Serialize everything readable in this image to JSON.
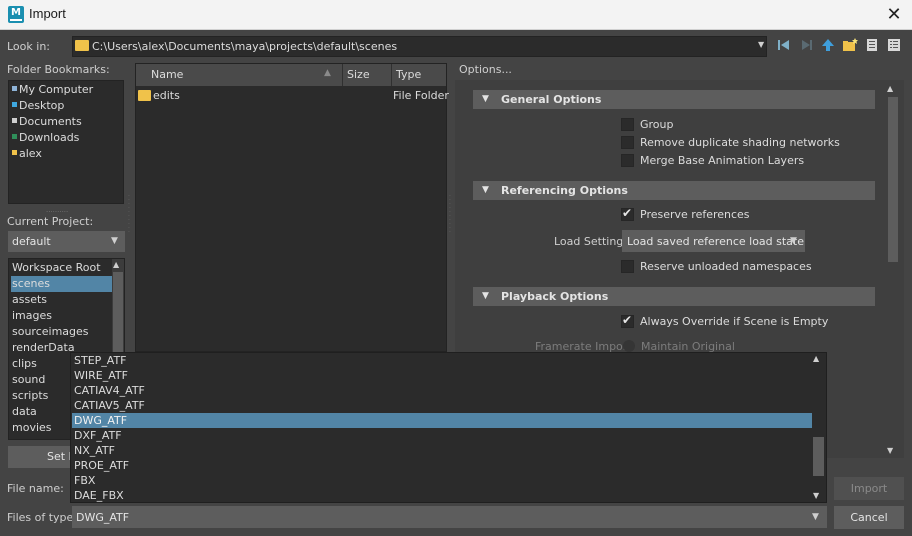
{
  "window": {
    "title": "Import",
    "app_icon": "M"
  },
  "look_in": {
    "label": "Look in:",
    "path": "C:\\Users\\alex\\Documents\\maya\\projects\\default\\scenes"
  },
  "toolbar": {
    "icons": [
      "back-icon",
      "forward-icon",
      "up-folder-icon",
      "new-folder-icon",
      "list-view-icon",
      "detail-view-icon"
    ]
  },
  "bookmarks": {
    "label": "Folder Bookmarks:",
    "items": [
      {
        "label": "My Computer",
        "color": "#8fb4d8"
      },
      {
        "label": "Desktop",
        "color": "#3fa8e0"
      },
      {
        "label": "Documents",
        "color": "#cfcfcf"
      },
      {
        "label": "Downloads",
        "color": "#2f8f5a"
      },
      {
        "label": "alex",
        "color": "#f0c24a"
      }
    ]
  },
  "project": {
    "label": "Current Project:",
    "value": "default",
    "items": [
      {
        "label": "Workspace Root",
        "selected": false
      },
      {
        "label": "scenes",
        "selected": true
      },
      {
        "label": "assets",
        "selected": false
      },
      {
        "label": "images",
        "selected": false
      },
      {
        "label": "sourceimages",
        "selected": false
      },
      {
        "label": "renderData",
        "selected": false
      },
      {
        "label": "clips",
        "selected": false
      },
      {
        "label": "sound",
        "selected": false
      },
      {
        "label": "scripts",
        "selected": false
      },
      {
        "label": "data",
        "selected": false
      },
      {
        "label": "movies",
        "selected": false
      }
    ],
    "set_project_label": "Set Pro"
  },
  "file_list": {
    "columns": [
      "Name",
      "Size",
      "Type"
    ],
    "rows": [
      {
        "name": "edits",
        "size": "",
        "type": "File Folder"
      }
    ]
  },
  "options": {
    "label": "Options...",
    "general": {
      "title": "General Options",
      "group": {
        "label": "Group",
        "checked": false
      },
      "remove_dup": {
        "label": "Remove duplicate shading networks",
        "checked": false
      },
      "merge_base": {
        "label": "Merge Base Animation Layers",
        "checked": false
      }
    },
    "referencing": {
      "title": "Referencing Options",
      "preserve": {
        "label": "Preserve references",
        "checked": true
      },
      "load_settings_label": "Load Settings",
      "load_settings_value": "Load saved reference load state",
      "reserve": {
        "label": "Reserve unloaded namespaces",
        "checked": false
      }
    },
    "playback": {
      "title": "Playback Options",
      "always_override": {
        "label": "Always Override if Scene is Empty",
        "checked": true
      },
      "framerate_label": "Framerate Import",
      "framerate_value": "Maintain Original"
    }
  },
  "bottom": {
    "file_name_label": "File name:",
    "files_of_type_label": "Files of type:",
    "files_of_type_value": "DWG_ATF",
    "import_label": "Import",
    "cancel_label": "Cancel"
  },
  "dropdown": {
    "items": [
      "STEP_ATF",
      "WIRE_ATF",
      "CATIAV4_ATF",
      "CATIAV5_ATF",
      "DWG_ATF",
      "DXF_ATF",
      "NX_ATF",
      "PROE_ATF",
      "FBX",
      "DAE_FBX"
    ],
    "selected": "DWG_ATF"
  }
}
